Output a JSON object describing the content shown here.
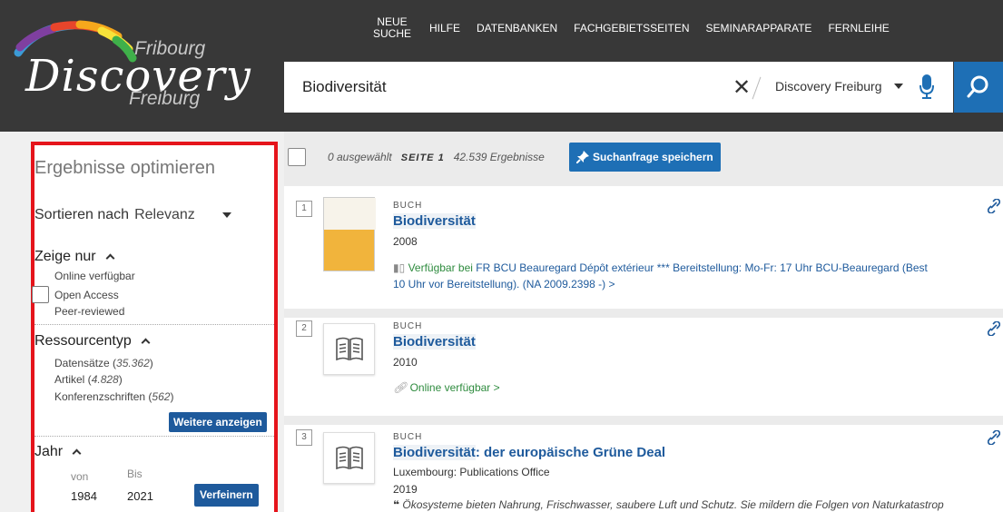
{
  "logo": {
    "line1": "Fribourg",
    "line2": "Discovery",
    "line3": "Freiburg"
  },
  "nav": {
    "items": [
      "NEUE SUCHE",
      "HILFE",
      "DATENBANKEN",
      "FACHGEBIETSSEITEN",
      "SEMINARAPPARATE",
      "FERNLEIHE"
    ]
  },
  "search": {
    "query": "Biodiversität",
    "scope": "Discovery Freiburg"
  },
  "colors": {
    "header_bg": "#383838",
    "accent_blue": "#1e6fb5",
    "sidebar_outline": "#e5141b",
    "available_green": "#2e8b3e"
  },
  "sidebar": {
    "title": "Ergebnisse optimieren",
    "sort_label": "Sortieren nach",
    "sort_value": "Relevanz",
    "show_only": {
      "heading": "Zeige nur",
      "items": [
        "Online verfügbar",
        "Open Access",
        "Peer-reviewed"
      ]
    },
    "resource_type": {
      "heading": "Ressourcentyp",
      "items": [
        {
          "label": "Datensätze",
          "count": "35.362"
        },
        {
          "label": "Artikel",
          "count": "4.828"
        },
        {
          "label": "Konferenzschriften",
          "count": "562"
        }
      ],
      "more_button": "Weitere anzeigen"
    },
    "year": {
      "heading": "Jahr",
      "from_label": "von",
      "to_label": "Bis",
      "from_value": "1984",
      "to_value": "2021",
      "refine_button": "Verfeinern"
    }
  },
  "toolbar": {
    "selected": "0 ausgewählt",
    "page": "SEITE 1",
    "count": "42.539 Ergebnisse",
    "save_button": "Suchanfrage speichern"
  },
  "results": [
    {
      "number": "1",
      "type": "BUCH",
      "title_hl": "Biodiversität",
      "title_rest": "",
      "year": "2008",
      "avail_prefix": "Verfügbar bei",
      "avail_location": "FR BCU Beauregard",
      "avail_detail": " Dépôt extérieur *** Bereitstellung: Mo-Fr: 17 Uhr BCU-Beauregard (Best",
      "avail_line2": "10 Uhr vor Bereitstellung). (NA 2009.2398 -)  >"
    },
    {
      "number": "2",
      "type": "BUCH",
      "title_hl": "Biodiversität",
      "title_rest": "",
      "year": "2010",
      "online": "Online verfügbar  >"
    },
    {
      "number": "3",
      "type": "BUCH",
      "title_hl": "Biodiversität",
      "title_rest": ": der europäische Grüne Deal",
      "publisher": "Luxembourg: Publications Office",
      "year": "2019",
      "quote": "Ökosysteme bieten Nahrung, Frischwasser, saubere Luft und Schutz. Sie mildern die Folgen von Naturkatastrop"
    }
  ]
}
